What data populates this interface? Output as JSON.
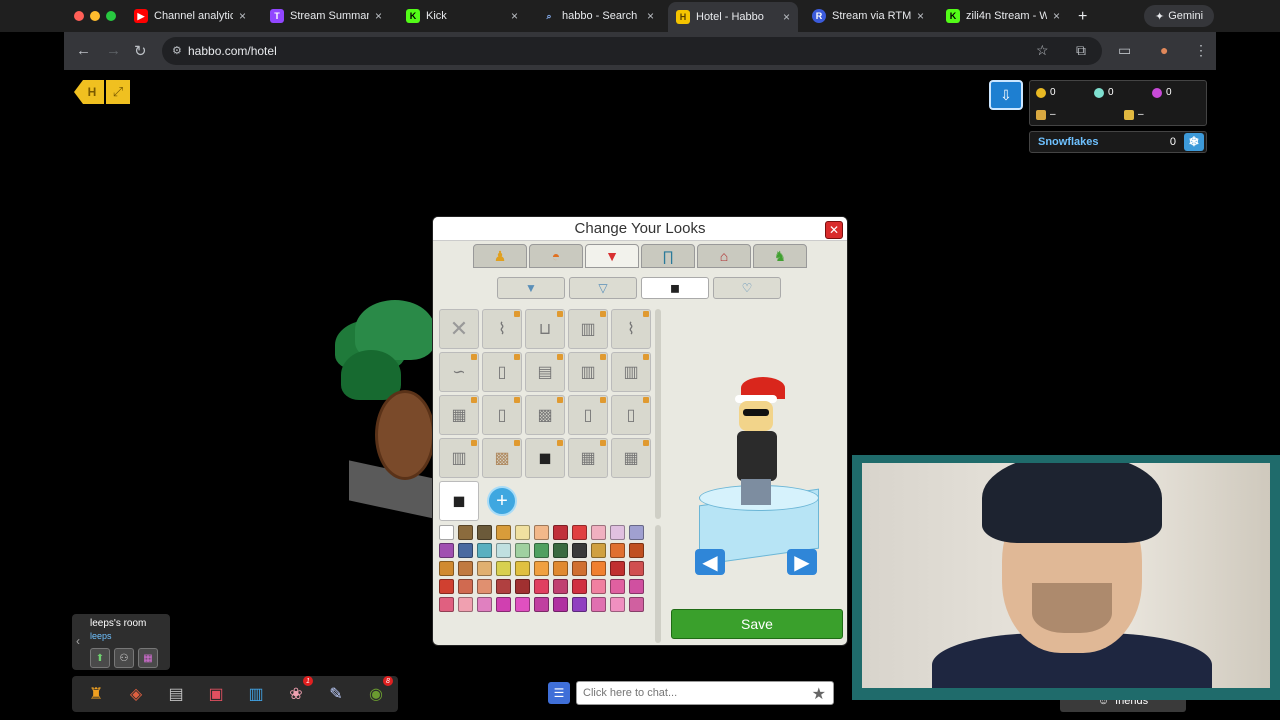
{
  "browser": {
    "tabs": [
      {
        "label": "Channel analytic",
        "fav_color": "#ff0000",
        "fav": "▶"
      },
      {
        "label": "Stream Summary",
        "fav_color": "#9146ff",
        "fav": "T"
      },
      {
        "label": "Kick",
        "fav_color": "#53fc18",
        "fav": "K"
      },
      {
        "label": "habbo - Search",
        "fav_color": "#202124",
        "fav": "⌕"
      },
      {
        "label": "Hotel - Habbo",
        "fav_color": "#f5c400",
        "fav": "H"
      },
      {
        "label": "Stream via RTMP",
        "fav_color": "#3b5bdb",
        "fav": "R"
      },
      {
        "label": "zili4n Stream - W",
        "fav_color": "#53fc18",
        "fav": "K"
      }
    ],
    "gemini_label": "Gemini",
    "url": "habbo.com/hotel"
  },
  "hud": {
    "purse": {
      "credits": "0",
      "diamonds": "0",
      "duckets": "0",
      "club_value": "–",
      "builders_value": "–"
    },
    "snowflakes_label": "Snowflakes",
    "snowflakes_value": "0"
  },
  "dialog": {
    "title": "Change Your Looks",
    "categories": [
      "body-icon",
      "hat-icon",
      "shirt-icon",
      "pants-icon",
      "hanger-icon",
      "pet-icon"
    ],
    "subcategories": [
      "tshirt-icon",
      "shirt-alt-icon",
      "jacket-icon",
      "accessory-icon"
    ],
    "save_label": "Save",
    "swatch_colors": [
      "#ffffff",
      "#8b6b3d",
      "#6b5a3a",
      "#d89c3a",
      "#f0e0a0",
      "#f2b88a",
      "#c0303a",
      "#e04040",
      "#f0b0c0",
      "#e0c0e0",
      "#a0a0d0",
      "#a050b0",
      "#4a6aa0",
      "#5ab0c0",
      "#c0e0e0",
      "#a0d0a0",
      "#50a060",
      "#3a6a40",
      "#3a3a3a",
      "#d0a040",
      "#e07030",
      "#c05020",
      "#d08a30",
      "#c07a40",
      "#e0b070",
      "#d8d050",
      "#e0c040",
      "#f0a040",
      "#e08a30",
      "#d07030",
      "#f08030",
      "#c03030",
      "#d05050",
      "#d04030",
      "#d06a50",
      "#e09070",
      "#b04040",
      "#a03030",
      "#e04060",
      "#c04070",
      "#d03040",
      "#f080a0",
      "#e060a0",
      "#d050a0",
      "#e06080",
      "#f0a0b0",
      "#e080c0",
      "#d040b0",
      "#e050c0",
      "#c040a0",
      "#b030a0",
      "#9040c0",
      "#e070b0",
      "#f090c0",
      "#d060a0"
    ]
  },
  "room": {
    "name": "leeps's room",
    "owner": "leeps"
  },
  "dock": {
    "items": [
      "hotel-view-icon",
      "builders-icon",
      "catalog-icon",
      "shop-icon",
      "inventory-icon",
      "pet-icon",
      "navigator-icon",
      "avatar-icon"
    ],
    "badge_count": "1",
    "avatar_badge": "8"
  },
  "chat": {
    "placeholder": "Click here to chat..."
  },
  "friends_label": "friends"
}
